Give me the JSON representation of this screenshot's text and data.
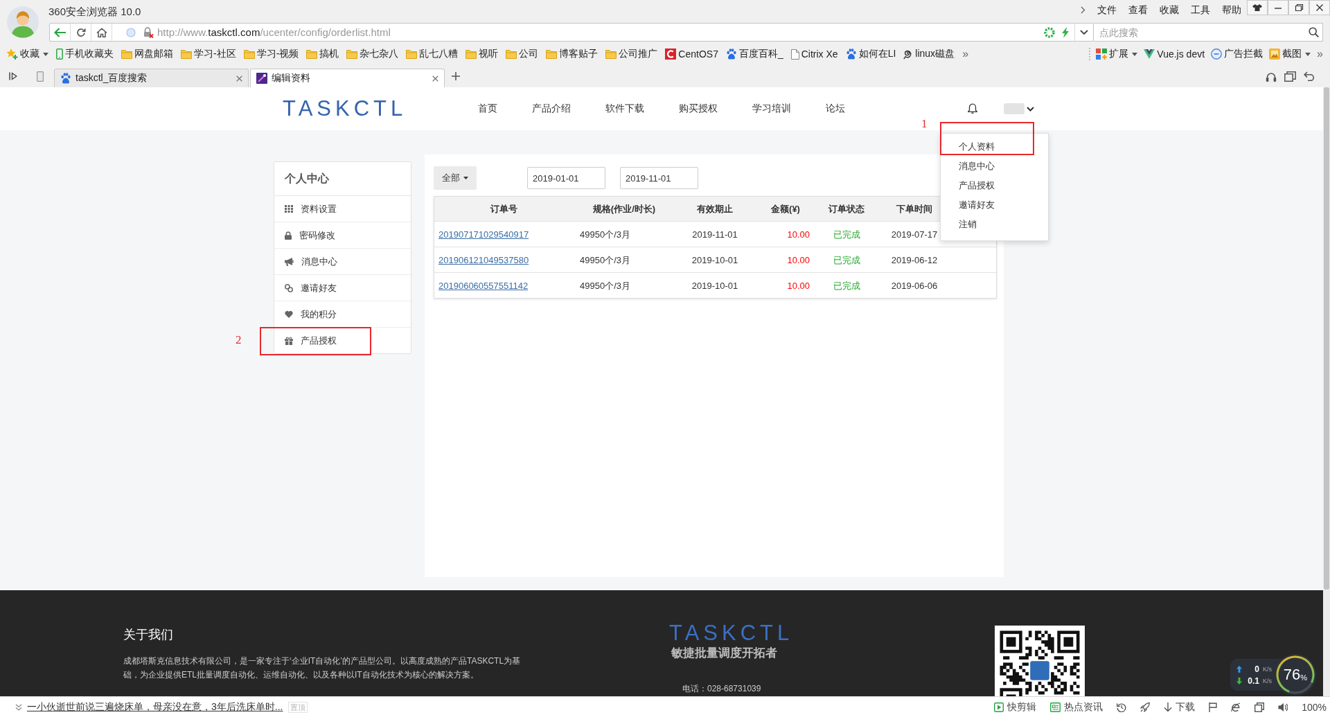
{
  "browser": {
    "title": "360安全浏览器 10.0",
    "menu": [
      "文件",
      "查看",
      "收藏",
      "工具",
      "帮助"
    ],
    "address": "http://www.**taskctl.com**/ucenter/config/orderlist.html",
    "search": {
      "placeholder": "点此搜索"
    },
    "bookmarks": {
      "items": [
        {
          "label": "收藏",
          "kind": "favorites"
        },
        {
          "label": "手机收藏夹",
          "kind": "mobile"
        },
        {
          "label": "网盘邮箱",
          "kind": "folder"
        },
        {
          "label": "学习-社区",
          "kind": "folder"
        },
        {
          "label": "学习-视频",
          "kind": "folder"
        },
        {
          "label": "搞机",
          "kind": "folder"
        },
        {
          "label": "杂七杂八",
          "kind": "folder"
        },
        {
          "label": "乱七八糟",
          "kind": "folder"
        },
        {
          "label": "视听",
          "kind": "folder"
        },
        {
          "label": "公司",
          "kind": "folder"
        },
        {
          "label": "博客贴子",
          "kind": "folder"
        },
        {
          "label": "公司推广",
          "kind": "folder"
        },
        {
          "label": "CentOS7",
          "kind": "brand"
        },
        {
          "label": "百度百科_",
          "kind": "paw"
        },
        {
          "label": "Citrix Xe",
          "kind": "page"
        },
        {
          "label": "如何在LI",
          "kind": "paw"
        },
        {
          "label": "linux磁盘",
          "kind": "script"
        }
      ],
      "more": "»"
    },
    "extensions": {
      "items": [
        {
          "label": "扩展",
          "kind": "apps",
          "has_menu": true
        },
        {
          "label": "Vue.js devt",
          "kind": "vue",
          "has_menu": false
        },
        {
          "label": "广告拦截",
          "kind": "adblock",
          "has_menu": false
        },
        {
          "label": "截图",
          "kind": "screenshot",
          "has_menu": true
        }
      ],
      "more": "»"
    },
    "tabs": [
      {
        "title": "taskctl_百度搜索",
        "kind": "paw",
        "selected": false
      },
      {
        "title": "编辑资料",
        "kind": "site",
        "selected": true
      }
    ]
  },
  "site": {
    "logo": "TASKCTL",
    "nav": [
      "首页",
      "产品介绍",
      "软件下载",
      "购买授权",
      "学习培训",
      "论坛"
    ],
    "user_menu": [
      {
        "label": "个人资料",
        "annotation": "1"
      },
      {
        "label": "消息中心"
      },
      {
        "label": "产品授权"
      },
      {
        "label": "邀请好友"
      },
      {
        "label": "注销"
      }
    ]
  },
  "sidebar": {
    "title": "个人中心",
    "items": [
      {
        "label": "资料设置"
      },
      {
        "label": "密码修改"
      },
      {
        "label": "消息中心"
      },
      {
        "label": "邀请好友"
      },
      {
        "label": "我的积分"
      },
      {
        "label": "产品授权",
        "annotation": "2"
      }
    ]
  },
  "orders": {
    "filter": {
      "status": "全部",
      "from": "2019-01-01",
      "to": "2019-11-01"
    },
    "columns": [
      "订单号",
      "规格(作业/时长)",
      "有效期止",
      "金额(¥)",
      "订单状态",
      "下单时间"
    ],
    "rows": [
      {
        "order_no": "201907171029540917",
        "spec": "49950个/3月",
        "expires": "2019-11-01",
        "amount": "10.00",
        "status": "已完成",
        "ordered": "2019-07-17"
      },
      {
        "order_no": "201906121049537580",
        "spec": "49950个/3月",
        "expires": "2019-10-01",
        "amount": "10.00",
        "status": "已完成",
        "ordered": "2019-06-12"
      },
      {
        "order_no": "201906060557551142",
        "spec": "49950个/3月",
        "expires": "2019-10-01",
        "amount": "10.00",
        "status": "已完成",
        "ordered": "2019-06-06"
      }
    ]
  },
  "footer": {
    "heading": "关于我们",
    "about": "成都塔斯克信息技术有限公司，是一家专注于‘企业IT自动化’的产品型公司。以高度成熟的产品TASKCTL为基础，为企业提供ETL批量调度自动化、运维自动化、以及各种以IT自动化技术为核心的解决方案。",
    "logo": "TASKCTL",
    "slogan": "敏捷批量调度开拓者",
    "phone": "电话：028-68731039"
  },
  "status_bar": {
    "headline": "一小伙逝世前说三遍烧床单，母亲没在意，3年后洗床单时...",
    "pin": "置顶",
    "tools": [
      {
        "label": "快剪辑",
        "kind": "clip"
      },
      {
        "label": "热点资讯",
        "kind": "news"
      },
      {
        "kind": "history"
      },
      {
        "kind": "rocket"
      },
      {
        "label": "下载",
        "kind": "download"
      },
      {
        "kind": "flag"
      },
      {
        "kind": "browser"
      },
      {
        "kind": "copy"
      },
      {
        "kind": "sound"
      }
    ],
    "zoom": "100%"
  },
  "monitor": {
    "upload": {
      "value": "0",
      "unit": "K/s"
    },
    "download": {
      "value": "0.1",
      "unit": "K/s"
    },
    "memory": {
      "value": "76",
      "unit": "%"
    }
  }
}
